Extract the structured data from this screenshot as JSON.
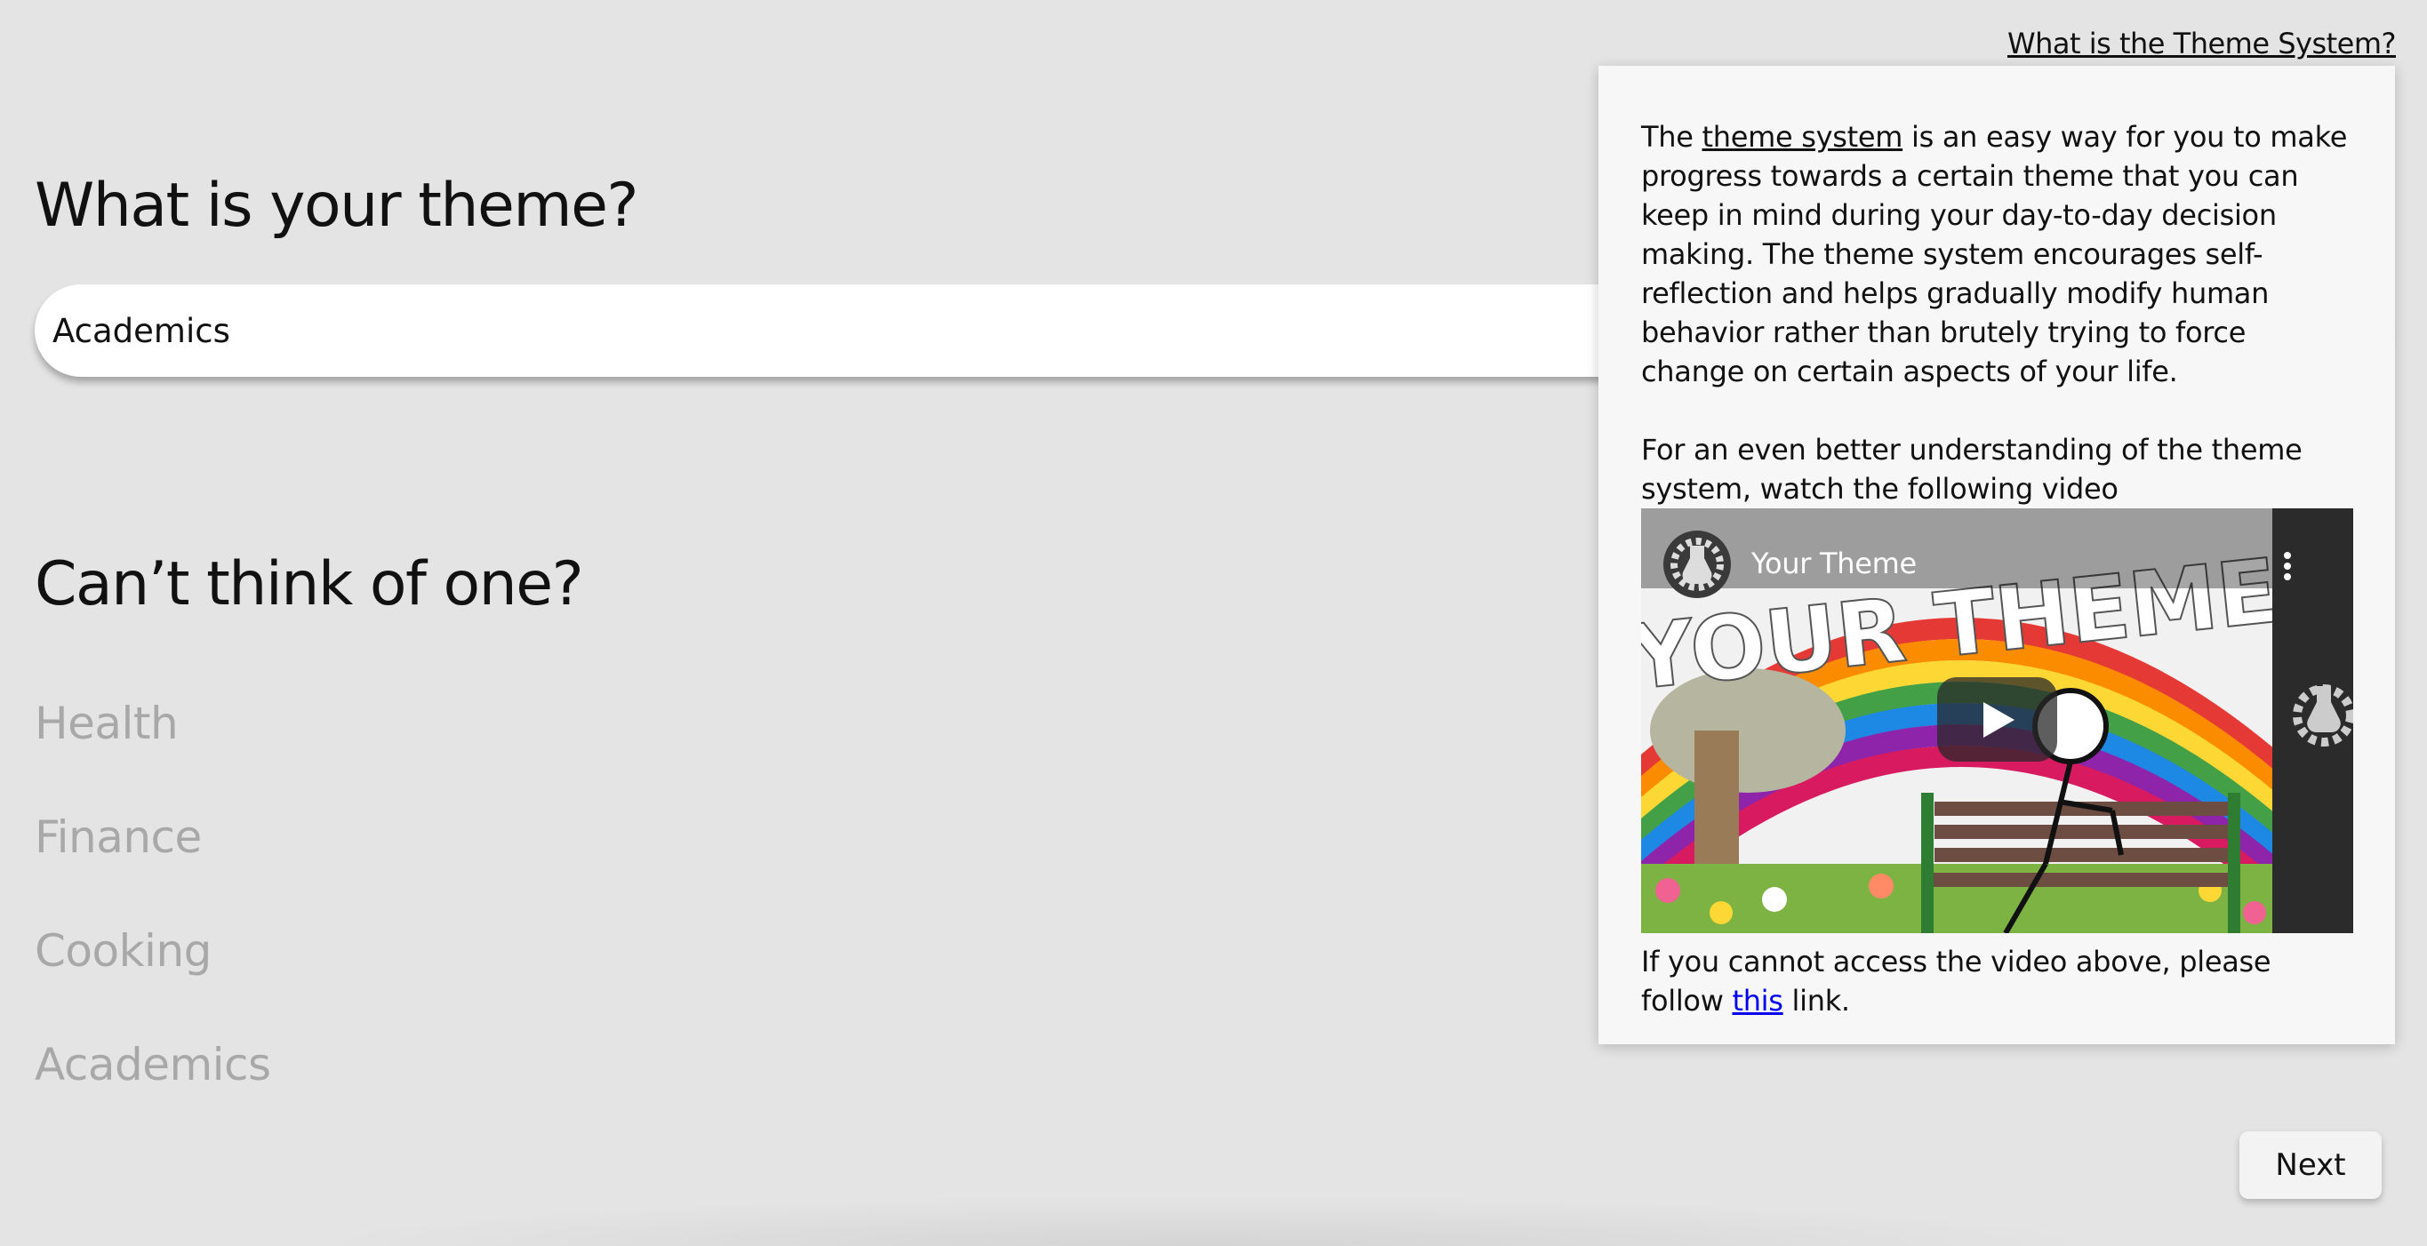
{
  "header": {
    "help_link": "What is the Theme System?"
  },
  "main": {
    "question": "What is your theme?",
    "theme_input_value": "Academics",
    "subheading": "Can’t think of one?",
    "suggestions": [
      "Health",
      "Finance",
      "Cooking",
      "Academics"
    ]
  },
  "popover": {
    "p1_before": "The ",
    "p1_link": "theme system",
    "p1_after": " is an easy way for you to make progress towards a certain theme that you can keep in mind during your day-to-day decision making. The theme system encourages self-reflection and helps gradually modify human behavior rather than brutely trying to force change on certain aspects of your life.",
    "p2": "For an even better understanding of the theme system, watch the following video",
    "video": {
      "title": "Your Theme",
      "thumbnail_text": "YOUR THEME",
      "icons": [
        "channel-logo-icon",
        "more-options-icon",
        "play-icon"
      ]
    },
    "p3_before": "If you cannot access the video above, please follow ",
    "p3_link": "this",
    "p3_after": " link."
  },
  "footer": {
    "next_label": "Next"
  },
  "colors": {
    "background": "#e4e4e4",
    "suggestion": "#a8a8a8",
    "link": "#0000ee",
    "popover_bg": "#f7f7f7"
  }
}
